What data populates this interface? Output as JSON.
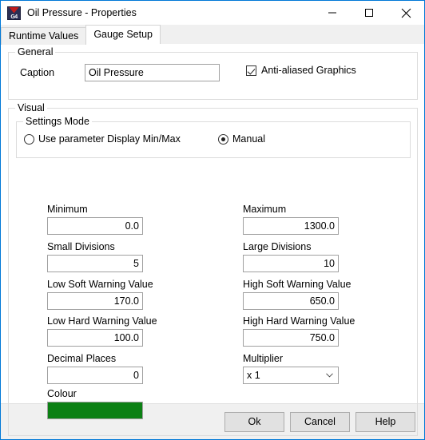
{
  "window": {
    "title": "Oil Pressure - Properties",
    "app_icon": "g4-app-icon",
    "minimize_label": "—",
    "maximize_label": "□",
    "close_label": "✕"
  },
  "tabs": [
    {
      "label": "Runtime Values",
      "active": false
    },
    {
      "label": "Gauge Setup",
      "active": true
    }
  ],
  "general": {
    "group_title": "General",
    "caption_label": "Caption",
    "caption_value": "Oil Pressure",
    "antialias_label": "Anti-aliased Graphics",
    "antialias_checked": true
  },
  "visual": {
    "group_title": "Visual",
    "settings_mode": {
      "group_title": "Settings Mode",
      "option_display_minmax": "Use parameter Display Min/Max",
      "option_manual": "Manual",
      "selected": "Manual"
    },
    "fields": {
      "minimum": {
        "label": "Minimum",
        "value": "0.0"
      },
      "maximum": {
        "label": "Maximum",
        "value": "1300.0"
      },
      "small_divisions": {
        "label": "Small Divisions",
        "value": "5"
      },
      "large_divisions": {
        "label": "Large Divisions",
        "value": "10"
      },
      "low_soft_warning": {
        "label": "Low Soft Warning Value",
        "value": "170.0"
      },
      "high_soft_warning": {
        "label": "High Soft Warning Value",
        "value": "650.0"
      },
      "low_hard_warning": {
        "label": "Low Hard Warning Value",
        "value": "100.0"
      },
      "high_hard_warning": {
        "label": "High Hard Warning Value",
        "value": "750.0"
      },
      "decimal_places": {
        "label": "Decimal Places",
        "value": "0"
      },
      "multiplier": {
        "label": "Multiplier",
        "value": "x 1"
      },
      "colour": {
        "label": "Colour",
        "value": "#0c8014"
      }
    }
  },
  "footer": {
    "ok_label": "Ok",
    "cancel_label": "Cancel",
    "help_label": "Help"
  },
  "colors": {
    "window_border": "#0078d7",
    "colour_swatch": "#0c8014",
    "dialog_face": "#f0f0f0",
    "client": "#ffffff"
  }
}
